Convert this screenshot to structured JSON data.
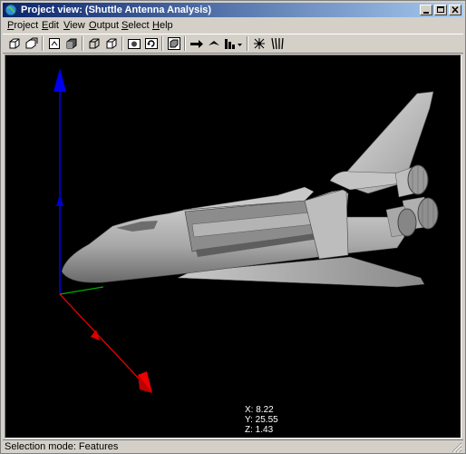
{
  "window": {
    "title": "Project view: (Shuttle Antenna Analysis)"
  },
  "menubar": {
    "items": [
      "Project",
      "Edit",
      "View",
      "Output",
      "Select",
      "Help"
    ]
  },
  "toolbar": {
    "buttons": [
      "front-view-icon",
      "iso-view-icon",
      "scene-frame-icon",
      "shaded-solid-icon",
      "wireframe-box-icon",
      "box-outline-icon",
      "camera-icon",
      "rotate-icon",
      "cube-select-icon",
      "arrow-right-icon",
      "wing-icon",
      "bar-chart-icon",
      "antenna-burst-icon",
      "antenna-array-icon"
    ]
  },
  "viewport": {
    "background": "#000000",
    "axis_colors": {
      "x": "#ff0000",
      "y": "#00aa00",
      "z": "#0000ff"
    },
    "coords": {
      "x": "X: 8.22",
      "y": "Y: 25.55",
      "z": "Z: 1.43"
    }
  },
  "statusbar": {
    "text": "Selection mode: Features"
  }
}
